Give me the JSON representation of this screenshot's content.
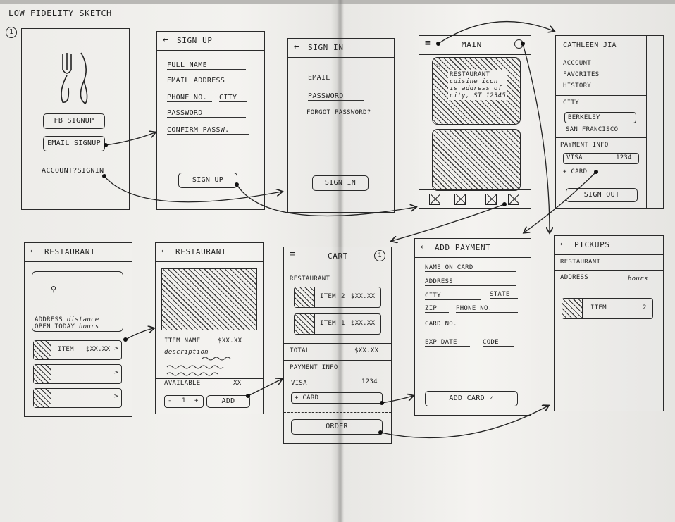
{
  "title": "LOW FIDELITY SKETCH",
  "page_number": "1",
  "screens": {
    "login": {
      "fb_signup": "FB SIGNUP",
      "email_signup": "EMAIL SIGNUP",
      "account_signin": "ACCOUNT?SIGNIN"
    },
    "signup": {
      "title": "SIGN UP",
      "fields": [
        "FULL NAME",
        "EMAIL ADDRESS",
        "PHONE NO.",
        "CITY",
        "PASSWORD",
        "CONFIRM PASSW."
      ],
      "button": "SIGN UP"
    },
    "signin": {
      "title": "SIGN IN",
      "email": "EMAIL",
      "password": "PASSWORD",
      "forgot": "FORGOT PASSWORD?",
      "button": "SIGN IN"
    },
    "main": {
      "title": "MAIN",
      "card_name": "RESTAURANT",
      "card_line1": "cuisine icon",
      "card_line2": "is address of",
      "card_line3": "city, ST 12345"
    },
    "menu": {
      "user": "CATHLEEN JIA",
      "items": [
        "ACCOUNT",
        "FAVORITES",
        "HISTORY"
      ],
      "city_label": "CITY",
      "cities": [
        "BERKELEY",
        "SAN FRANCISCO"
      ],
      "payment_label": "PAYMENT INFO",
      "card_type": "VISA",
      "card_num": "1234",
      "add_card": "+ CARD",
      "signout": "SIGN OUT"
    },
    "restaurant1": {
      "title": "RESTAURANT",
      "address": "ADDRESS",
      "distance": "distance",
      "open": "OPEN TODAY",
      "hours": "hours",
      "item": "ITEM",
      "price": "$XX.XX"
    },
    "restaurant2": {
      "title": "RESTAURANT",
      "item_name": "ITEM NAME",
      "price": "$XX.XX",
      "description": "description",
      "available": "AVAILABLE",
      "available_qty": "XX",
      "qty": "1",
      "minus": "-",
      "plus": "+",
      "add": "ADD"
    },
    "cart": {
      "title": "CART",
      "count": "1",
      "restaurant": "RESTAURANT",
      "items": [
        {
          "name": "ITEM",
          "qty": "2",
          "price": "$XX.XX"
        },
        {
          "name": "ITEM",
          "qty": "1",
          "price": "$XX.XX"
        }
      ],
      "total_label": "TOTAL",
      "total": "$XX.XX",
      "payment_label": "PAYMENT INFO",
      "card_type": "VISA",
      "card_num": "1234",
      "add_card": "+ CARD",
      "order": "ORDER"
    },
    "add_payment": {
      "title": "ADD PAYMENT",
      "fields": [
        "NAME ON CARD",
        "ADDRESS",
        "CITY",
        "STATE",
        "ZIP",
        "PHONE NO.",
        "CARD NO.",
        "EXP DATE",
        "CODE"
      ],
      "button": "ADD CARD ✓"
    },
    "pickups": {
      "title": "PICKUPS",
      "restaurant": "RESTAURANT",
      "address": "ADDRESS",
      "hours": "hours",
      "item": "ITEM",
      "qty": "2"
    }
  }
}
